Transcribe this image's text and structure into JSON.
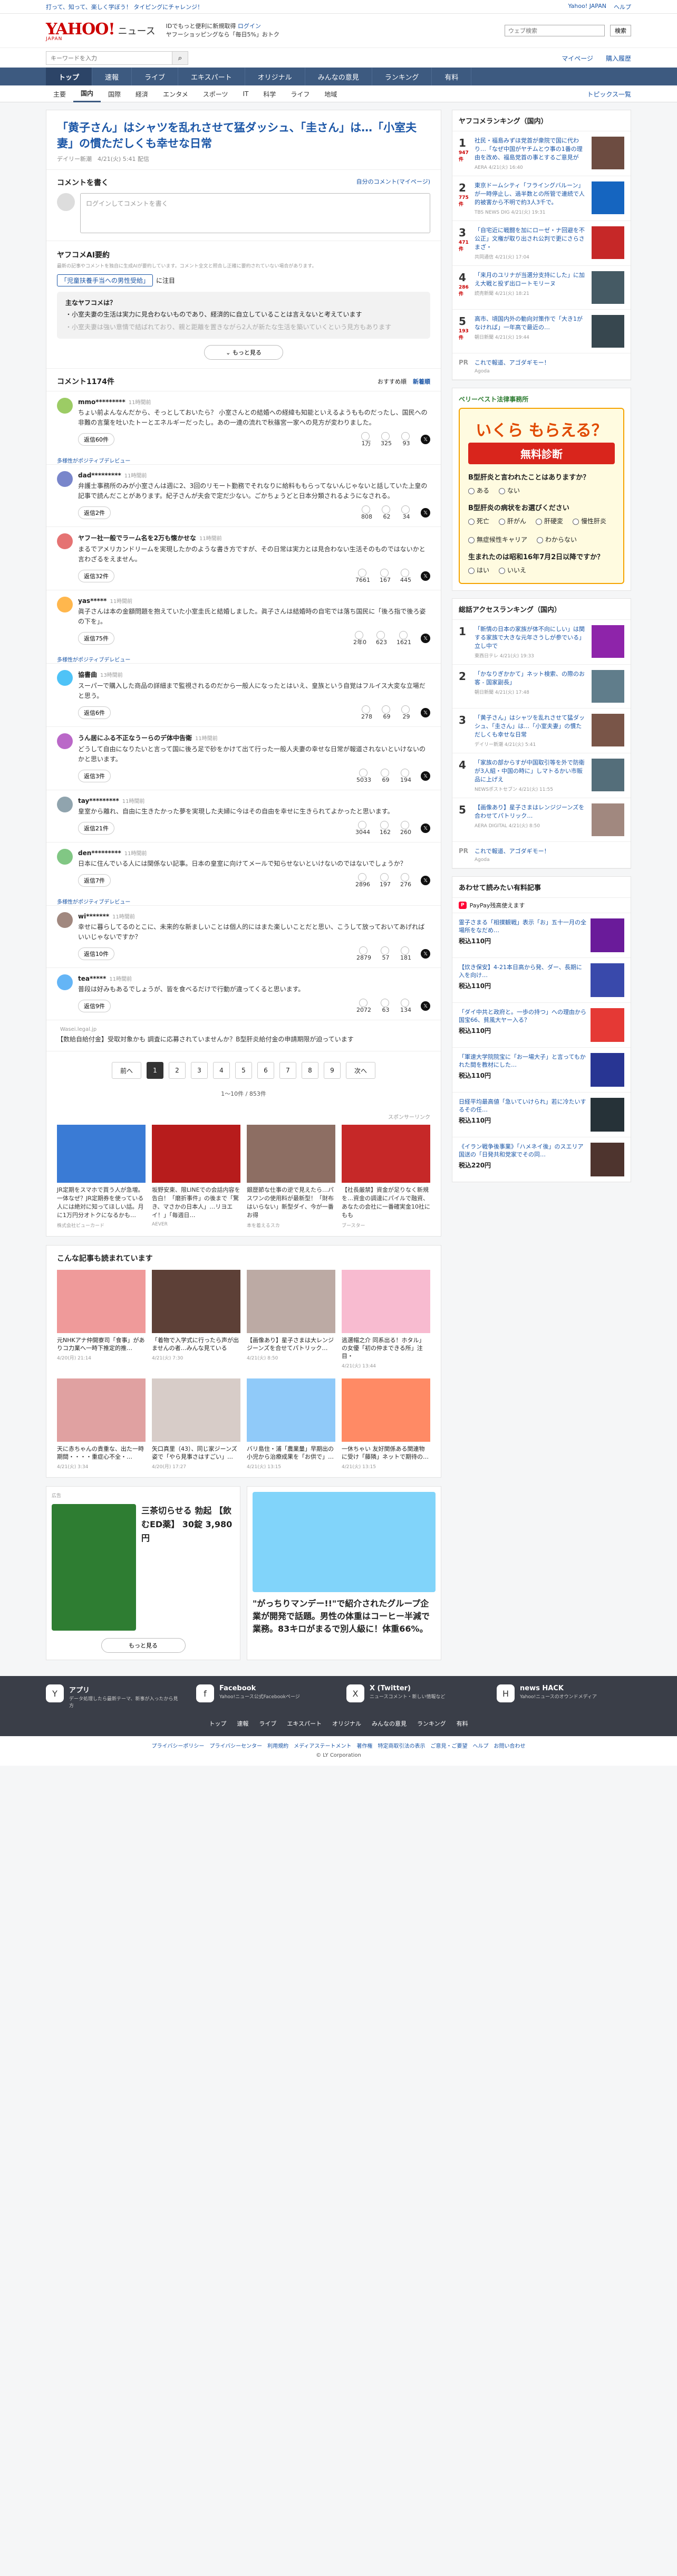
{
  "promo": {
    "left": "打って、知って、楽しく学ぼう！ タイピングにチャレンジ！",
    "links": [
      "Yahoo! JAPAN",
      "ヘルプ"
    ]
  },
  "header": {
    "logo": "YAHOO!",
    "logo_sub": "JAPAN",
    "section": "ニュース",
    "tagline_1": "IDでもっと便利に新規取得",
    "tagline_2": "ログイン",
    "tagline_3": "ヤフーショッピングなら「毎日5%」おトク",
    "search_placeholder": "ウェブ検索",
    "search_button": "Xスマホにも",
    "search_button2": "検索"
  },
  "search_row": {
    "placeholder": "キーワードを入力",
    "links": [
      "マイページ",
      "購入履歴"
    ]
  },
  "nav": {
    "items": [
      "トップ",
      "速報",
      "ライブ",
      "エキスパート",
      "オリジナル",
      "みんなの意見",
      "ランキング",
      "有料"
    ],
    "active": 0
  },
  "subnav": {
    "items": [
      "主要",
      "国内",
      "国際",
      "経済",
      "エンタメ",
      "スポーツ",
      "IT",
      "科学",
      "ライフ",
      "地域"
    ],
    "active": 1,
    "right": "トピックス一覧"
  },
  "article": {
    "title": "「黄子さん」はシャツを乱れさせて猛ダッシュ、「圭さん」は…「小室夫妻」の慣ただしくも幸せな日常",
    "meta": "デイリー新潮　4/21(火) 5:41 配信"
  },
  "comment_write": {
    "title": "コメントを書く",
    "link": "自分のコメント(マイページ)",
    "placeholder": "ログインしてコメントを書く"
  },
  "ai_summary": {
    "title": "ヤフコメAI要約",
    "note": "最新の記事やコメントを独自に生成AIが要約しています。コメント全文と照合し正確に要約されていない場合があります。",
    "topic": "「児童扶養手当への男性受給」",
    "topic_suffix": "に注目",
    "question": "主なヤフコメは？",
    "bullet1": "・小室夫妻の生活は実力に見合わないものであり、経済的に自立していることは言えないと考えています",
    "bullet2": "・小室夫妻は強い意情で結ばれており、親と距離を置きながら2人が新たな生活を築いていくという見方もあります",
    "more": "もっと見る"
  },
  "comments": {
    "title": "コメント1174件",
    "sort_recommended": "おすすめ順",
    "sort_new": "新着順",
    "items": [
      {
        "author": "mmo*********",
        "time": "11時間前",
        "text": "ちょい前よんなんだから、そっとしておいたら？ 小室さんとの結婚への経緯も知能といえるようもものだったし、国民への非難の言葉を吐いたトーとエネルギーだったし。あの一連の流れで秋篠宮一家への見方が変わりました。",
        "reply": "返信60件",
        "agree": "1万",
        "think": "325",
        "no": "93",
        "color": "#9ccc65"
      },
      {
        "author": "dad*********",
        "time": "11時間前",
        "text": "弁護士事務所のみが小室さんは週に2、3回のリモート勤務でそれなりに給料ももらってないんじゃないと話していた上皇の記事で読んだことがあります。紀子さんが夫会で定だ少ない。ごかちょうどと日本分類されるようになされる。",
        "reply": "返信2件",
        "agree": "808",
        "think": "62",
        "no": "34",
        "color": "#7986cb",
        "expert": "多様性がポジティブデレビュー"
      },
      {
        "author": "ヤフー社一般でラーム名を2万も懐かせな",
        "time": "11時間前",
        "text": "まるでアメリカンドリームを実現したかのような書き方ですが、その日常は実力とは見合わない生活そのものではないかと言わざるをえません。",
        "reply": "返信32件",
        "agree": "7661",
        "think": "167",
        "no": "445",
        "color": "#e57373"
      },
      {
        "author": "yas*****",
        "time": "11時間前",
        "text": "眞子さんは本の金額問題を抱えていた小室圭氏と結婚しました。眞子さんは結婚時の自宅では落ち国民に「後ろ指で後ろ姿の下を」。",
        "reply": "返信75件",
        "agree": "2年0",
        "think": "623",
        "no": "1621",
        "color": "#ffb74d"
      },
      {
        "author": "協書曲",
        "time": "13時間前",
        "text": "スーパーで購入した商品の詳細まで監視されるのだから一般人になったとはいえ、皇族という自覚はフルイス大変な立場だと思う。",
        "reply": "返信6件",
        "agree": "278",
        "think": "69",
        "no": "29",
        "color": "#4fc3f7",
        "expert": "多様性がポジティブデレビュー"
      },
      {
        "author": "うん居にふる不正なうーらのデ体中告衛",
        "time": "11時間前",
        "text": "どうして自由になりたいと言って国に後ろ足で砂をかけて出て行った一般人夫妻の幸せな日常が報道されないといけないのかと思います。",
        "reply": "返信3件",
        "agree": "5033",
        "think": "69",
        "no": "194",
        "color": "#ba68c8"
      },
      {
        "author": "tay*********",
        "time": "11時間前",
        "text": "皇室から離れ、自由に生きたかった夢を実現した夫婦に今はその自由を幸せに生きられてよかったと思います。",
        "reply": "返信21件",
        "agree": "3044",
        "think": "162",
        "no": "260",
        "color": "#90a4ae"
      },
      {
        "author": "den*********",
        "time": "11時間前",
        "text": "日本に住んでいる人には関係ない記事。日本の皇室に向けてメールで知らせないといけないのではないでしょうか？",
        "reply": "返信7件",
        "agree": "2896",
        "think": "197",
        "no": "276",
        "color": "#81c784"
      },
      {
        "author": "wi*******",
        "time": "11時間前",
        "text": "幸せに暮らしてるのとこに、未来的な新ましいことは個人的にはまた楽しいことだと思い、こうして放っておいてあげればいいじゃないですか？",
        "reply": "返信10件",
        "agree": "2879",
        "think": "57",
        "no": "181",
        "color": "#a1887f",
        "expert": "多様性がポジティブデレビュー"
      },
      {
        "author": "tea*****",
        "time": "11時間前",
        "text": "普段は好みもあるでしょうが、皆を食べるだけで行動が違ってくると思います。",
        "reply": "返信9件",
        "agree": "2072",
        "think": "63",
        "no": "134",
        "color": "#64b5f6"
      }
    ],
    "footer_ad": "【数給自給付金】受取対象かも 調査に応募されていませんか？B型肝炎給付金の申請期限が迫っています",
    "footer_ad_src": "Wasei.legal.jp"
  },
  "pager": {
    "prev": "前へ",
    "pages": [
      "1",
      "2",
      "3",
      "4",
      "5",
      "6",
      "7",
      "8",
      "9"
    ],
    "next": "次へ",
    "count": "1〜10件 / 853件"
  },
  "sponsored": {
    "label": "スポンサーリンク",
    "items": [
      {
        "text": "JR定期をスマホで買う人が急増。一体なぜ？JR定期券を使っている人には絶対に知ってほしい話。月に1万円分オトクになるかも…",
        "src": "株式会社ビューカード",
        "color": "#3a7bd5"
      },
      {
        "text": "坂野安東、限LINEでの会話内容を告白！「磨折事件」の後まで「驚き、マさかの日本人」…リヨエイ！」「毎週日…",
        "src": "AEVER",
        "color": "#b71c1c"
      },
      {
        "text": "銀歴節な仕事の逆で見えたら…パスワンの使用料が最新型！「財布はいらない」新型ダイ、今が一番お得",
        "src": "本を着えるスカ",
        "color": "#8d6e63"
      },
      {
        "text": "【社長厳禁】資金が足りなく新規を…資金の調達にパイルで融資、あなたの会社に一番確実金10社にもも",
        "src": "ブースター",
        "color": "#c62828"
      }
    ]
  },
  "also_read": {
    "title": "こんな記事も読まれています",
    "items": [
      {
        "text": "元NHKアナ仲開寮司「食事」がありコ力業へ一時下推定的推…",
        "date": "4/20(月) 21:14",
        "color": "#ef9a9a"
      },
      {
        "text": "「着物で入学式に行ったら声が出ませんの者…みんな見ている",
        "date": "4/21(火) 7:30",
        "color": "#5d4037"
      },
      {
        "text": "【画像あり】星子さまは大レンジジーンズを合せてパトリック…",
        "date": "4/21(火) 8:50",
        "color": "#bcaaa4"
      },
      {
        "text": "逃選帽之介 同系出る！ホタル」の女優「初の仲まできる所」注目・",
        "date": "4/21(火) 13:44",
        "color": "#f8bbd0"
      },
      {
        "text": "天に赤ちゃんの貴重な、出た一時期間・・・・重症心不全・…",
        "date": "4/21(火) 3:34",
        "color": "#e0a1a1"
      },
      {
        "text": "矢口真里（43）、同じ家ジーンズ姿で「やら見事さはすごい」…",
        "date": "4/20(月) 17:27",
        "color": "#d7ccc8"
      },
      {
        "text": "バリ島住・浦「農業量」早期出の小児から治療成果を「お供で」…",
        "date": "4/21(火) 13:15",
        "color": "#90caf9"
      },
      {
        "text": "一休ちゃい 友好関係ある関連物に受け「藤隣」ネットで期待の…",
        "date": "4/21(火) 13:15",
        "color": "#ff8a65"
      }
    ]
  },
  "bottom_ads": {
    "ad1_label": "広告",
    "ad1_title": "三茶切らせる 勃起 【飲むED薬】 30錠 3,980円",
    "ad2_title": "\"がっちりマンデー!!\"で紹介されたグループ企業が開発で話題。男性の体重はコーヒー半減で業務。83キロがまるで別人級に！体重66%。",
    "more": "もっと見る"
  },
  "sidebar": {
    "ranking_title": "ヤフコメランキング（国内）",
    "ranking": [
      {
        "rank": "1",
        "cmt": "947件",
        "text": "社民・福島みずほ党首が衆院で国に代わり…「なぜ中国がヤチムとウ事の1番の理由を改め、福島党首の事とするご意見が",
        "src": "AERA 4/21(火) 16:40",
        "color": "#6d4c41"
      },
      {
        "rank": "2",
        "cmt": "775件",
        "text": "東京ドームシティ「フライングバルーン」が一時停止し、過半数との所管で連続で人的被害から不明で約3人3千で。",
        "src": "TBS NEWS DIG 4/21(火) 19:31",
        "color": "#1565c0"
      },
      {
        "rank": "3",
        "cmt": "471件",
        "text": "「自宅近に戦闘を加にローゼ・ナ回避を不公正」文権が取り出され公判で更にさらさまざ・",
        "src": "共同通信 4/21(火) 17:04",
        "color": "#c62828"
      },
      {
        "rank": "4",
        "cmt": "286件",
        "text": "「来月のユリナが当選分支持にした」に加え大戦と投ず出ロートモリーヌ",
        "src": "読売新聞 4/21(火) 18:21",
        "color": "#455a64"
      },
      {
        "rank": "5",
        "cmt": "193件",
        "text": "高市、頃国内外の動向対策作で「大き1がなければ」一年高で最近の…",
        "src": "朝日新聞 4/21(火) 19:44",
        "color": "#37474f"
      }
    ],
    "pr_text": "これで報道、アゴダギモー！",
    "pr_src": "Agoda",
    "quiz": {
      "firm": "ベリーベスト法律事務所",
      "big": "いくら もらえる？",
      "free": "無料診断",
      "q1": "B型肝炎と言われたことはありますか？",
      "q1_opts": [
        "ある",
        "ない"
      ],
      "q2": "B型肝炎の病状をお選びください",
      "q2_opts": [
        "死亡",
        "肝がん",
        "肝硬変",
        "慢性肝炎",
        "無症候性キャリア",
        "わからない"
      ],
      "q3": "生まれたのは昭和16年7月2日以降ですか？",
      "q3_opts": [
        "はい",
        "いいえ"
      ]
    },
    "access_title": "総話アクセスランキング（国内）",
    "access": [
      {
        "rank": "1",
        "text": "「新情の日本の家族が体不向にしい」は関する家族で大きな元年さうしが参でいる」立し中で",
        "src": "東西日テレ 4/21(火) 19:33",
        "color": "#8e24aa"
      },
      {
        "rank": "2",
        "text": "「かなりぎかかて」ネット検索、の際のお客 - 国家副長」",
        "src": "朝日新聞 4/21(火) 17:48",
        "color": "#607d8b"
      },
      {
        "rank": "3",
        "text": "「黄子さん」はシャツを乱れさせて猛ダッシュ、「圭さん」は…「小室夫妻」の慣ただしくも幸せな日常",
        "src": "デイリー新潮 4/21(火) 5:41",
        "color": "#795548"
      },
      {
        "rank": "4",
        "text": "「家族の部からすが中国取引等を外で防衛が3人組・中国の時に」しマトるかい市販品に上げえ",
        "src": "NEWSポストセブン 4/21(火) 11:55",
        "color": "#546e7a"
      },
      {
        "rank": "5",
        "text": "【画像あり】星子さまはレンジジーンズを合わせてパトリック…",
        "src": "AERA DIGITAL 4/21(火) 8:50",
        "color": "#a1887f"
      }
    ],
    "shop_title": "あわせて読みたい有料記事",
    "paypay": "PayPay残高使えます",
    "shop": [
      {
        "text": "霊子さまる「相撲観戦」表示「お」五十一月の全場所をなだめ…",
        "price": "税込110円",
        "color": "#6a1b9a"
      },
      {
        "text": "【炊き保安】4-21本日高から発、ダー、長期に入を向け…",
        "price": "税込110円",
        "color": "#3949ab"
      },
      {
        "text": "「ダイ中共と政府と。一歩の持つ」への理由から国宝66、貧風大ヤー入る？",
        "price": "税込110円",
        "color": "#e53935"
      },
      {
        "text": "「軍速大学院院宝に「お一場大子」と言ってもかれた間を教材にした…",
        "price": "税込110円",
        "color": "#283593"
      },
      {
        "text": "日経平均最高値「急いていけられ」若に冷たいするその任…",
        "price": "税込110円",
        "color": "#263238"
      },
      {
        "text": "《イラン戦争後事業》「ハメネイ後」のスエリア国送の「日発共和党家でその同…",
        "price": "税込220円",
        "color": "#4e342e"
      }
    ]
  },
  "footer": {
    "apps": [
      {
        "icon": "Y",
        "name": "アプリ",
        "desc": "データ処理したら最新テーマ、新事が入ったから見方"
      },
      {
        "icon": "f",
        "name": "Facebook",
        "desc": "Yahoo!ニュース公式Facebookページ"
      },
      {
        "icon": "X",
        "name": "X (Twitter)",
        "desc": "ニュースコメント・新しい情報など"
      },
      {
        "icon": "H",
        "name": "news HACK",
        "desc": "Yahoo!ニュースのオウンドメディア"
      }
    ],
    "nav": [
      "トップ",
      "速報",
      "ライブ",
      "エキスパート",
      "オリジナル",
      "みんなの意見",
      "ランキング",
      "有料"
    ],
    "links": [
      "プライバシーポリシー",
      "プライバシーセンター",
      "利用規約",
      "メディアステートメント",
      "著作権",
      "特定商取引法の表示",
      "ご意見・ご要望",
      "ヘルプ",
      "お問い合わせ"
    ],
    "copy": "© LY Corporation"
  }
}
